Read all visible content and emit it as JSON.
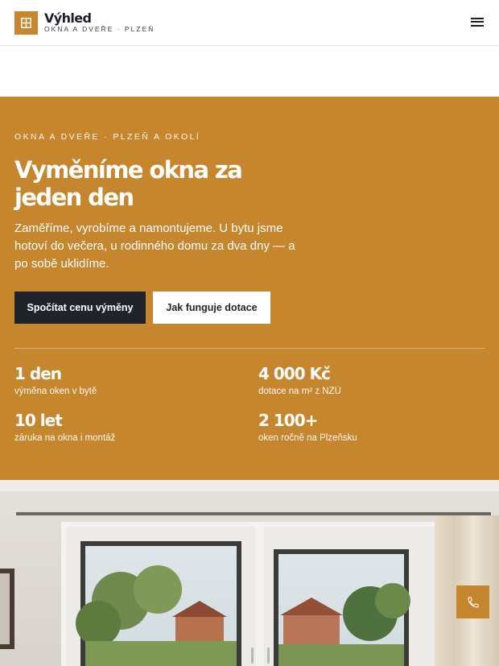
{
  "brand": {
    "name": "Výhled",
    "tagline": "OKNA A DVEŘE · PLZEŇ"
  },
  "nav": {
    "menu_icon": "hamburger-menu-icon"
  },
  "hero": {
    "eyebrow": "OKNA A DVEŘE · PLZEŇ A OKOLÍ",
    "title": "Vyměníme okna za jeden den",
    "lede": "Zaměříme, vyrobíme a namontujeme. U bytu jsme hotoví do večera, u rodinného domu za dva dny — a po sobě uklidíme.",
    "primary_cta": "Spočítat cenu výměny",
    "secondary_cta": "Jak funguje dotace",
    "stats": [
      {
        "value": "1 den",
        "label": "výměna oken v bytě"
      },
      {
        "value": "4 000 Kč",
        "label": "dotace na m² z NZÚ"
      },
      {
        "value": "10 let",
        "label": "záruka na okna i montáž"
      },
      {
        "value": "2 100+",
        "label": "oken ročně na Plzeňsku"
      }
    ]
  },
  "floating": {
    "call_icon": "phone-icon"
  },
  "colors": {
    "accent": "#c6862e",
    "dark": "#1f242a",
    "white": "#ffffff"
  }
}
